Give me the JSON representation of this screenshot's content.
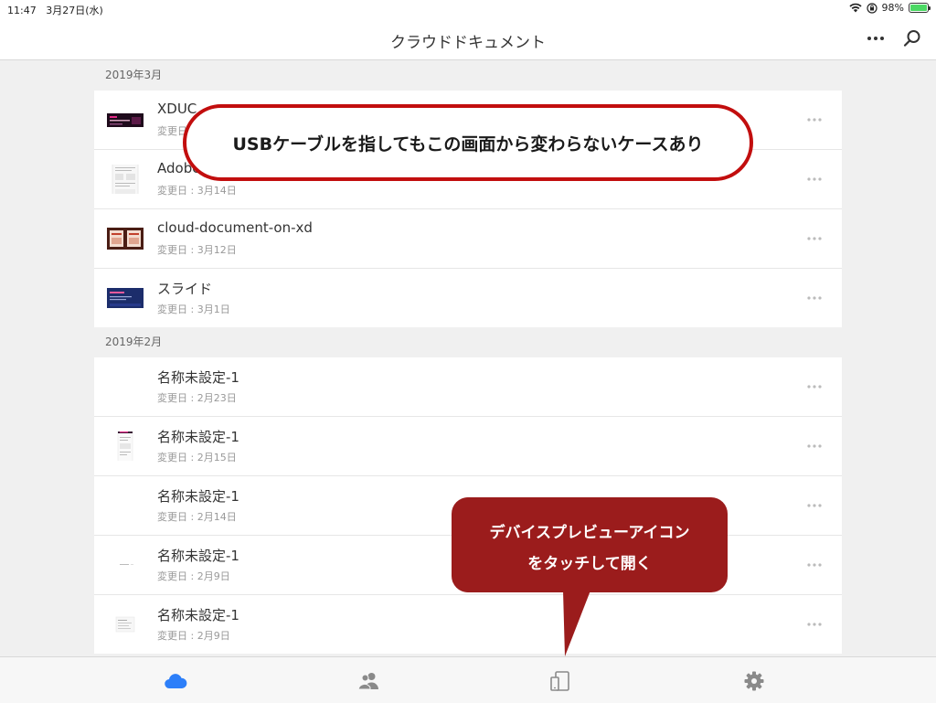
{
  "status_bar": {
    "time": "11:47",
    "date": "3月27日(水)",
    "battery_percent": "98%",
    "battery_level": 0.98
  },
  "header": {
    "title": "クラウドドキュメント"
  },
  "sections": [
    {
      "header": "2019年3月",
      "items": [
        {
          "name": "XDUC",
          "date": "変更日 : 3月",
          "thumb": "dark-pink-banner"
        },
        {
          "name": "Adobe XD",
          "date": "変更日 : 3月14日",
          "thumb": "document-page"
        },
        {
          "name": "cloud-document-on-xd",
          "date": "変更日 : 3月12日",
          "thumb": "red-cards"
        },
        {
          "name": "スライド",
          "date": "変更日 : 3月1日",
          "thumb": "navy-slide"
        }
      ]
    },
    {
      "header": "2019年2月",
      "items": [
        {
          "name": "名称未設定-1",
          "date": "変更日 : 2月23日",
          "thumb": "blank"
        },
        {
          "name": "名称未設定-1",
          "date": "変更日 : 2月15日",
          "thumb": "mobile-page"
        },
        {
          "name": "名称未設定-1",
          "date": "変更日 : 2月14日",
          "thumb": "blank"
        },
        {
          "name": "名称未設定-1",
          "date": "変更日 : 2月9日",
          "thumb": "tiny-line"
        },
        {
          "name": "名称未設定-1",
          "date": "変更日 : 2月9日",
          "thumb": "small-doc"
        }
      ]
    }
  ],
  "callouts": {
    "usb_note": "USBケーブルを指してもこの画面から変わらないケースあり",
    "device_preview_line1": "デバイスプレビューアイコン",
    "device_preview_line2": "をタッチして開く"
  },
  "tabbar": {
    "tabs": [
      "cloud-icon",
      "people-icon",
      "device-preview-icon",
      "settings-gear-icon"
    ],
    "active_color": "#2d7ff9",
    "inactive_color": "#8a8a8a"
  },
  "colors": {
    "callout_border": "#c20e0e",
    "callout_fill": "#9b1c1c"
  }
}
